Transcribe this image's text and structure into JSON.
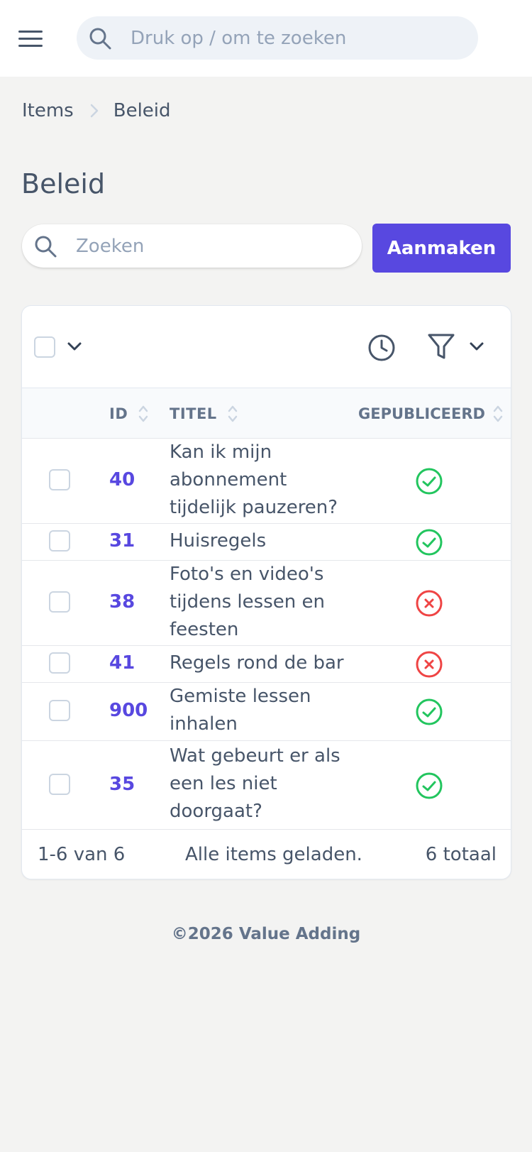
{
  "header": {
    "menu_icon": "hamburger-menu-icon",
    "search_placeholder": "Druk op / om te zoeken"
  },
  "breadcrumb": {
    "items": [
      "Items",
      "Beleid"
    ]
  },
  "page": {
    "title": "Beleid",
    "search_placeholder": "Zoeken",
    "create_label": "Aanmaken"
  },
  "table": {
    "columns": [
      "ID",
      "TITEL",
      "GEPUBLICEERD"
    ],
    "rows": [
      {
        "id": "40",
        "title": "Kan ik mijn abonnement tijdelijk pauzeren?",
        "published": true
      },
      {
        "id": "31",
        "title": "Huisregels",
        "published": true
      },
      {
        "id": "38",
        "title": "Foto's en video's tijdens lessen en feesten",
        "published": false
      },
      {
        "id": "41",
        "title": "Regels rond de bar",
        "published": false
      },
      {
        "id": "900",
        "title": "Gemiste lessen inhalen",
        "published": true
      },
      {
        "id": "35",
        "title": "Wat gebeurt er als een les niet doorgaat?",
        "published": true
      }
    ],
    "footer": {
      "range": "1-6 van 6",
      "status": "Alle items geladen.",
      "total": "6 totaal"
    }
  },
  "footer": {
    "copyright": "©2026 Value Adding"
  },
  "colors": {
    "accent": "#5848e0",
    "published": "#22c55e",
    "unpublished": "#ef4444"
  }
}
